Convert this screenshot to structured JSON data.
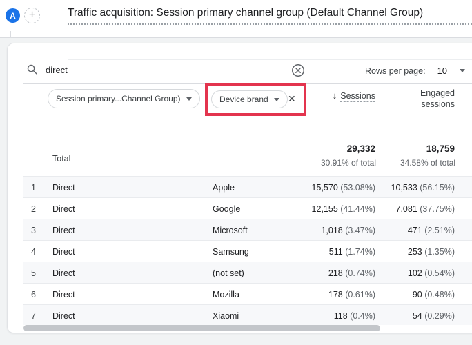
{
  "topbar": {
    "avatar_letter": "A",
    "new_tab_label": "+",
    "title": "Traffic acquisition: Session primary channel group (Default Channel Group)"
  },
  "toolbar": {
    "search_value": "direct",
    "rows_per_page_label": "Rows per page:",
    "rows_per_page_value": "10"
  },
  "filters": {
    "primary_chip": "Session primary...Channel Group)",
    "secondary_chip": "Device brand",
    "remove_label": "✕"
  },
  "table": {
    "sort_arrow": "↓",
    "col_sessions": "Sessions",
    "col_engaged_line1": "Engaged",
    "col_engaged_line2": "sessions",
    "total": {
      "label": "Total",
      "sessions": "29,332",
      "sessions_share": "30.91% of total",
      "engaged": "18,759",
      "engaged_share": "34.58% of total"
    },
    "rows": [
      {
        "num": "1",
        "channel": "Direct",
        "brand": "Apple",
        "sessions": "15,570",
        "sessions_pct": "(53.08%)",
        "engaged": "10,533",
        "engaged_pct": "(56.15%)"
      },
      {
        "num": "2",
        "channel": "Direct",
        "brand": "Google",
        "sessions": "12,155",
        "sessions_pct": "(41.44%)",
        "engaged": "7,081",
        "engaged_pct": "(37.75%)"
      },
      {
        "num": "3",
        "channel": "Direct",
        "brand": "Microsoft",
        "sessions": "1,018",
        "sessions_pct": "(3.47%)",
        "engaged": "471",
        "engaged_pct": "(2.51%)"
      },
      {
        "num": "4",
        "channel": "Direct",
        "brand": "Samsung",
        "sessions": "511",
        "sessions_pct": "(1.74%)",
        "engaged": "253",
        "engaged_pct": "(1.35%)"
      },
      {
        "num": "5",
        "channel": "Direct",
        "brand": "(not set)",
        "sessions": "218",
        "sessions_pct": "(0.74%)",
        "engaged": "102",
        "engaged_pct": "(0.54%)"
      },
      {
        "num": "6",
        "channel": "Direct",
        "brand": "Mozilla",
        "sessions": "178",
        "sessions_pct": "(0.61%)",
        "engaged": "90",
        "engaged_pct": "(0.48%)"
      },
      {
        "num": "7",
        "channel": "Direct",
        "brand": "Xiaomi",
        "sessions": "118",
        "sessions_pct": "(0.4%)",
        "engaged": "54",
        "engaged_pct": "(0.29%)"
      }
    ]
  },
  "colors": {
    "highlight_red": "#e3344e",
    "avatar_blue": "#1a73e8"
  }
}
